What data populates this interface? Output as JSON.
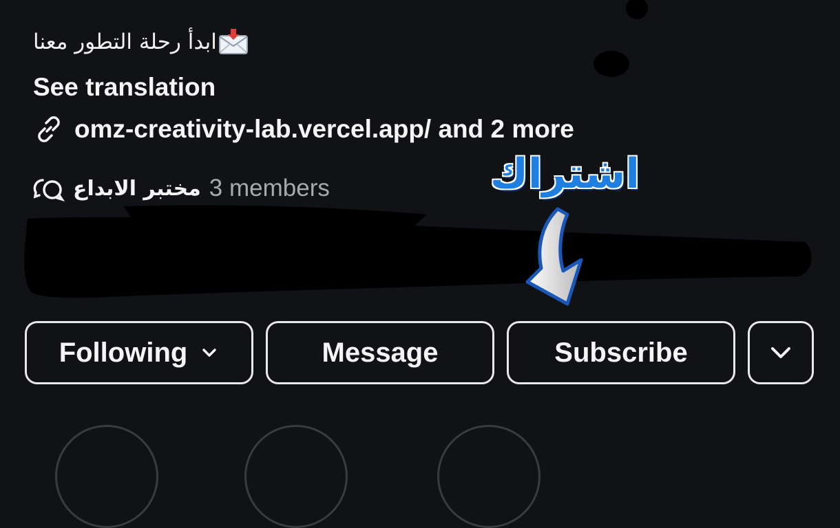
{
  "profile": {
    "bio_text": "ابدأ رحلة التطور معنا",
    "bio_icon": "incoming-envelope-icon",
    "see_translation": "See translation",
    "link_text": "omz-creativity-lab.vercel.app/ and 2 more",
    "channel_name": "مختبر الابداع",
    "channel_members": "3 members"
  },
  "annotation": {
    "label": "اشتراك",
    "color": "#1e7fe0"
  },
  "actions": {
    "following": "Following",
    "message": "Message",
    "subscribe": "Subscribe"
  },
  "colors": {
    "background": "#111216",
    "text": "#f5f5f5",
    "muted": "#a7a9ae",
    "border": "#e9e9ea"
  }
}
